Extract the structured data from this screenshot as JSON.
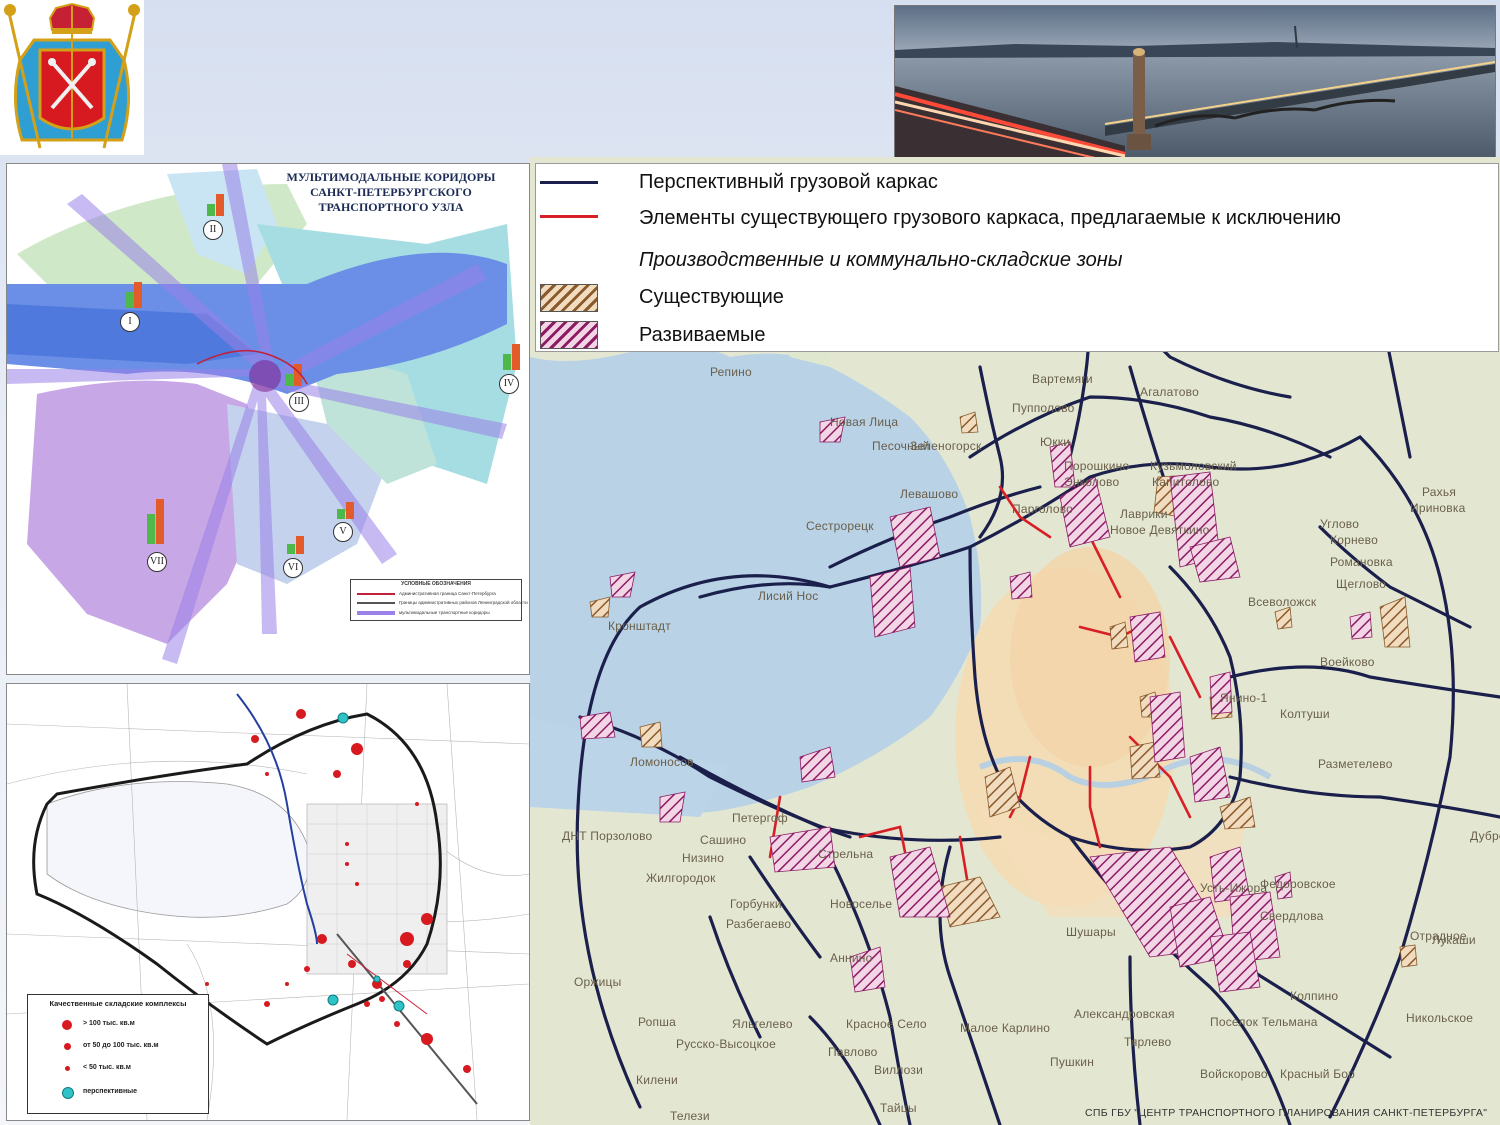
{
  "legend": {
    "items": [
      {
        "label": "Перспективный грузовой каркас",
        "color": "#1a1f4b"
      },
      {
        "label": "Элементы существующего грузового каркаса, предлагаемые к исключению",
        "color": "#d81f26"
      },
      {
        "label": "Производственные и коммунально-складские зоны",
        "italic": true
      },
      {
        "label": "Существующие",
        "color": "#a46a34"
      },
      {
        "label": "Развиваемые",
        "color": "#b0267a"
      }
    ]
  },
  "corridor_map": {
    "title_line1": "МУЛЬТИМОДАЛЬНЫЕ КОРИДОРЫ",
    "title_line2": "САНКТ-ПЕТЕРБУРГСКОГО ТРАНСПОРТНОГО УЗЛА",
    "corridors": [
      "I",
      "II",
      "III",
      "IV",
      "V",
      "VI",
      "VII"
    ],
    "legend_title": "УСЛОВНЫЕ ОБОЗНАЧЕНИЯ",
    "legend_rows": [
      "Административная граница Санкт-Петербурга",
      "Границы административных районов Ленинградской области",
      "мультимодальные транспортные коридоры"
    ]
  },
  "warehouse_map": {
    "legend_title": "Качественные складские комплексы",
    "rows": [
      {
        "label": "> 100 тыс. кв.м"
      },
      {
        "label": "от 50 до 100 тыс. кв.м"
      },
      {
        "label": "< 50 тыс. кв.м"
      },
      {
        "label": "перспективные"
      }
    ],
    "colors": {
      "dot": "#d71920",
      "future": "#2fc3c7"
    }
  },
  "places": [
    "Репино",
    "Вартемяги",
    "Агалатово",
    "Пупполово",
    "Зеленогорск",
    "Песочный",
    "Юкки",
    "Порошкино",
    "Энколово",
    "Кузьмоловский",
    "Капитолово",
    "Левашово",
    "Парголово",
    "Лаврики",
    "Новое Девяткино",
    "Сестрорецк",
    "Лисий Нос",
    "Кронштадт",
    "Всеволожск",
    "Романовка",
    "Щеглово",
    "Углово",
    "Корнево",
    "Рахья",
    "Ириновка",
    "Воейково",
    "Колтуши",
    "Янино-1",
    "Разметелево",
    "Ломоносов",
    "Петергоф",
    "Сашино",
    "Низино",
    "Жилгородок",
    "Стрельна",
    "Горбунки",
    "Разбегаево",
    "Новоселье",
    "Шушары",
    "Аннино",
    "Оржицы",
    "Ропша",
    "Яльгелево",
    "Красное Село",
    "Малое Карлино",
    "Александровская",
    "Тярлево",
    "Русско-Высоцкое",
    "Павлово",
    "Виллози",
    "Пушкин",
    "Колпино",
    "Отрадное",
    "Никольское",
    "Войскорово",
    "Красный Бор",
    "Килени",
    "Телези",
    "Тайцы",
    "Федоровское",
    "Усть-Ижора",
    "Свердлова",
    "Дубровка",
    "Лукаши",
    "ДНТ Порзолово",
    "Новая Лица",
    "Поселок Тельмана"
  ],
  "credit": "СПБ ГБУ \"ЦЕНТР ТРАНСПОРТНОГО ПЛАНИРОВАНИЯ САНКТ-ПЕТЕРБУРГА\""
}
